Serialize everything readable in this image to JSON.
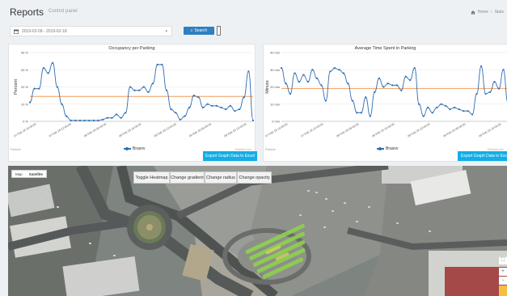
{
  "header": {
    "title": "Reports",
    "subtitle": "Control panel",
    "breadcrumb": [
      "Home",
      "Stats"
    ]
  },
  "toolbar": {
    "date_range": "2019-02-09 - 2019-02-18",
    "search_label": "Search"
  },
  "charts": [
    {
      "title": "Occupancy per Parking",
      "export_label": "Export Graph Data to Excel",
      "legend": "Brasov",
      "source_left": "Parkizer",
      "source_right": "Parkizer.com"
    },
    {
      "title": "Average Time Spent in Parking",
      "export_label": "Export Graph Data to Excel",
      "legend": "Brasov",
      "source_left": "Parkizer",
      "source_right": "Parkizer.com"
    }
  ],
  "chart_data": [
    {
      "type": "line",
      "title": "Occupancy per Parking",
      "ylabel": "Percent",
      "ylim": [
        0,
        40
      ],
      "yticks": [
        "0 %",
        "10 %",
        "20 %",
        "30 %",
        "40 %"
      ],
      "xticks": [
        "07 Feb 18 14:00:00",
        "07 Feb 18 22:00:00",
        "08 Feb 18 06:00:00",
        "08 Feb 18 14:00:00",
        "08 Feb 18 22:00:00",
        "09 Feb 18 06:00:00",
        "09 Feb 18 14:00:00"
      ],
      "series": [
        {
          "name": "Brasov",
          "values": [
            11,
            19,
            19,
            31,
            28,
            34,
            20,
            10,
            3,
            0.5,
            0.5,
            0.5,
            0.5,
            0.5,
            0.5,
            0.5,
            1,
            2,
            2,
            4,
            2,
            5,
            20,
            18,
            18,
            20,
            17,
            22,
            33,
            33,
            18,
            7,
            5,
            1,
            3,
            8,
            15,
            14,
            8,
            10,
            9,
            9,
            8,
            7,
            9,
            6,
            7,
            14,
            29,
            0.5
          ]
        }
      ],
      "reference_line": 14.5,
      "legend_position": "bottom"
    },
    {
      "type": "line",
      "title": "Average Time Spent in Parking",
      "ylabel": "Minute",
      "ylim": [
        0,
        40
      ],
      "yticks": [
        "0 min",
        "10 min",
        "20 min",
        "30 min",
        "40 min"
      ],
      "xticks": [
        "07 Feb 18 14:00:00",
        "07 Feb 18 22:00:00",
        "08 Feb 18 06:00:00",
        "08 Feb 18 14:00:00",
        "08 Feb 18 22:00:00",
        "09 Feb 18 06:00:00",
        "09 Feb 18 14:00:00"
      ],
      "series": [
        {
          "name": "Brasov",
          "values": [
            31,
            22,
            16,
            28,
            23,
            27,
            23,
            30,
            25,
            21,
            12,
            29,
            31,
            30,
            28,
            22,
            12,
            5,
            5,
            14,
            3,
            17,
            25,
            20,
            22,
            21,
            21,
            18,
            26,
            24,
            31,
            10,
            3,
            8,
            5,
            8,
            10,
            9,
            7,
            8,
            7,
            6,
            6,
            4,
            16,
            32,
            16,
            17,
            23,
            19,
            30,
            11
          ]
        }
      ],
      "reference_line": 19,
      "legend_position": "bottom"
    }
  ],
  "map": {
    "type_options": [
      "Map",
      "Satellite"
    ],
    "active_type": "Satellite",
    "buttons": [
      "Toggle Heatmap",
      "Change gradient",
      "Change radius",
      "Change opacity"
    ],
    "zoom_in": "+",
    "zoom_out": "−"
  },
  "colors": {
    "series": "#2f6fb5",
    "reference": "#ef8a3c",
    "export": "#12aee6",
    "search": "#2f7fc1"
  }
}
